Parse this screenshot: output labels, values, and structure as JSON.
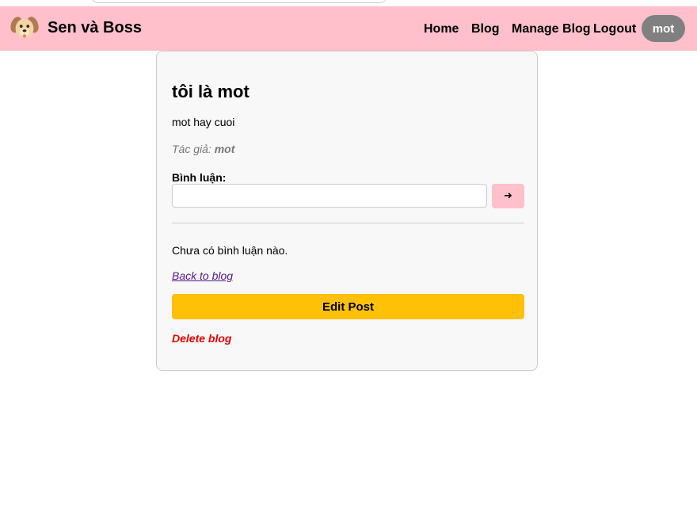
{
  "navbar": {
    "brand_name": "Sen và Boss",
    "brand_logo_icon": "dog-face-icon",
    "links": {
      "home": "Home",
      "blog": "Blog",
      "manage_blog": "Manage Blog",
      "logout": "Logout"
    },
    "user": "mot",
    "background_color": "#ffc0cb"
  },
  "post": {
    "title": "tôi là mot",
    "content": "mot hay cuoi",
    "author_label": "Tác giả: ",
    "author_name": "mot"
  },
  "comments": {
    "label": "Bình luận:",
    "input_value": "",
    "submit_label": "➜",
    "empty_text": "Chưa có bình luận nào."
  },
  "actions": {
    "back_label": "Back to blog",
    "edit_label": "Edit Post",
    "delete_label": "Delete blog",
    "edit_color": "#ffc107",
    "delete_color": "#e00000"
  }
}
